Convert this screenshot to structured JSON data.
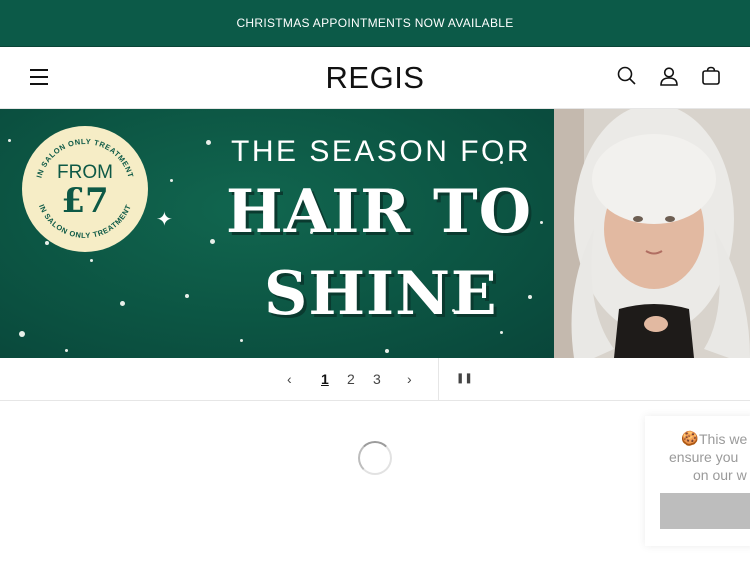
{
  "announcement": {
    "text": "CHRISTMAS APPOINTMENTS NOW AVAILABLE"
  },
  "header": {
    "logo": "REGIS",
    "icons": [
      "menu-icon",
      "search-icon",
      "account-icon",
      "cart-icon"
    ]
  },
  "hero": {
    "badge_ring_text": "IN SALON ONLY TREATMENT",
    "badge_from": "FROM",
    "badge_price": "£7",
    "headline_small": "THE SEASON FOR",
    "headline_line1": "HAIR TO",
    "headline_line2": "SHINE",
    "colors": {
      "background": "#0d5946",
      "badge": "#f6edc6"
    }
  },
  "slider": {
    "prev_label": "‹",
    "next_label": "›",
    "pages": [
      "1",
      "2",
      "3"
    ],
    "current_page": "1",
    "pause_label": "❚❚"
  },
  "cookie_banner": {
    "line1": "This we",
    "line2": "ensure you",
    "line3": "on our w"
  }
}
